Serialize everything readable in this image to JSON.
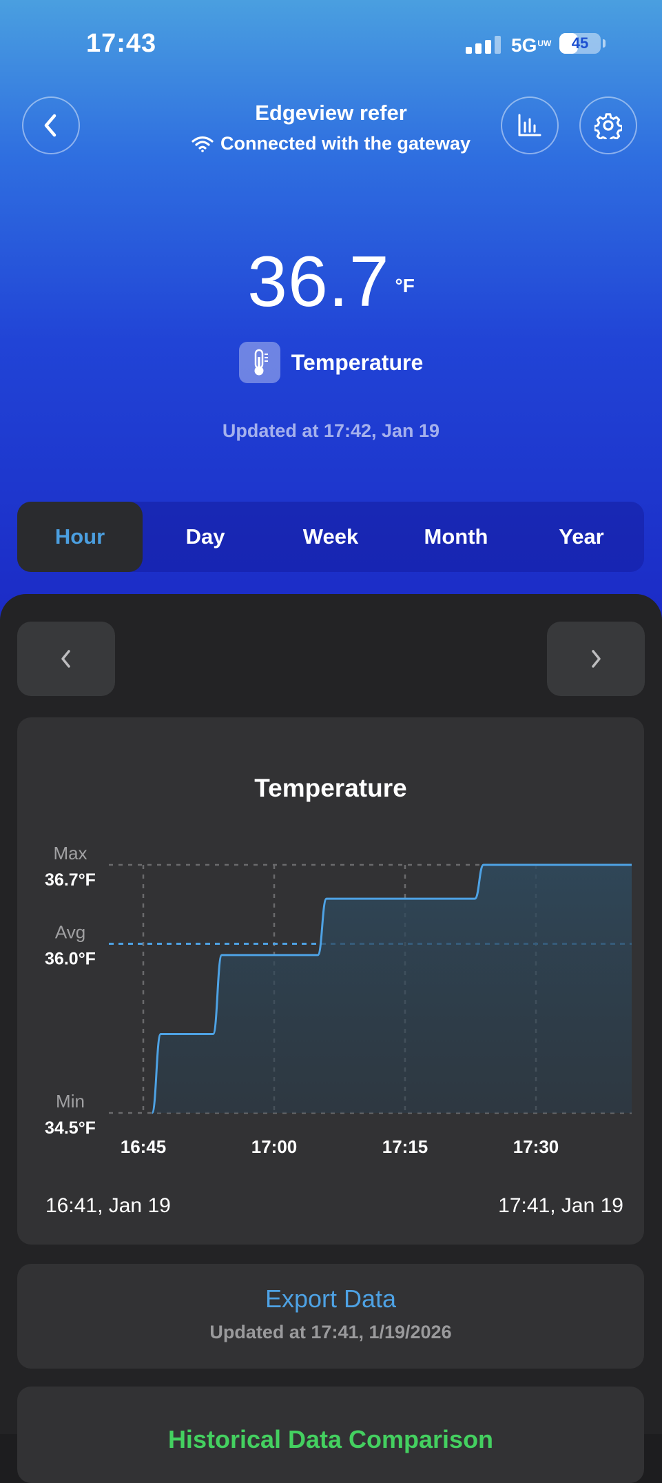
{
  "status_bar": {
    "time": "17:43",
    "network": "5G",
    "network_suffix": "UW",
    "battery": "45",
    "battery_level": 0.45
  },
  "nav": {
    "back_icon": "chevron-left-icon",
    "title": "Edgeview refer",
    "connection_status": "Connected with the gateway",
    "chart_icon": "bar-chart-icon",
    "settings_icon": "gear-icon"
  },
  "reading": {
    "value": "36.7",
    "unit": "°F",
    "sensor_label": "Temperature",
    "updated": "Updated at 17:42,  Jan 19"
  },
  "tabs": [
    {
      "label": "Hour",
      "active": true
    },
    {
      "label": "Day",
      "active": false
    },
    {
      "label": "Week",
      "active": false
    },
    {
      "label": "Month",
      "active": false
    },
    {
      "label": "Year",
      "active": false
    }
  ],
  "chart_card": {
    "range_start": "16:41,  Jan 19",
    "range_end": "17:41,  Jan 19"
  },
  "chart_data": {
    "type": "line",
    "title": "Temperature",
    "unit": "°F",
    "x_unit": "minutes",
    "x_ticks": [
      "16:45",
      "17:00",
      "17:15",
      "17:30"
    ],
    "x_tick_values": [
      "16:45",
      "17:00",
      "17:15",
      "17:30"
    ],
    "xlim": [
      "16:30",
      "17:41"
    ],
    "ylim": [
      34.5,
      36.7
    ],
    "reference_lines": [
      {
        "label": "Max",
        "value_label": "36.7°F",
        "value": 36.7
      },
      {
        "label": "Avg",
        "value_label": "36.0°F",
        "value": 36.0
      },
      {
        "label": "Min",
        "value_label": "34.5°F",
        "value": 34.5
      }
    ],
    "series": [
      {
        "color": "#4ea2e4",
        "points": [
          {
            "x": "16:46",
            "y": 34.5
          },
          {
            "x": "16:47",
            "y": 35.2
          },
          {
            "x": "16:53",
            "y": 35.2
          },
          {
            "x": "16:54",
            "y": 35.9
          },
          {
            "x": "17:05",
            "y": 35.9
          },
          {
            "x": "17:06",
            "y": 36.4
          },
          {
            "x": "17:23",
            "y": 36.4
          },
          {
            "x": "17:24",
            "y": 36.7
          },
          {
            "x": "17:41",
            "y": 36.7
          }
        ]
      }
    ],
    "grid": true
  },
  "export": {
    "title": "Export Data",
    "updated": "Updated at 17:41,  1/19/2026"
  },
  "history": {
    "title": "Historical Data Comparison"
  }
}
